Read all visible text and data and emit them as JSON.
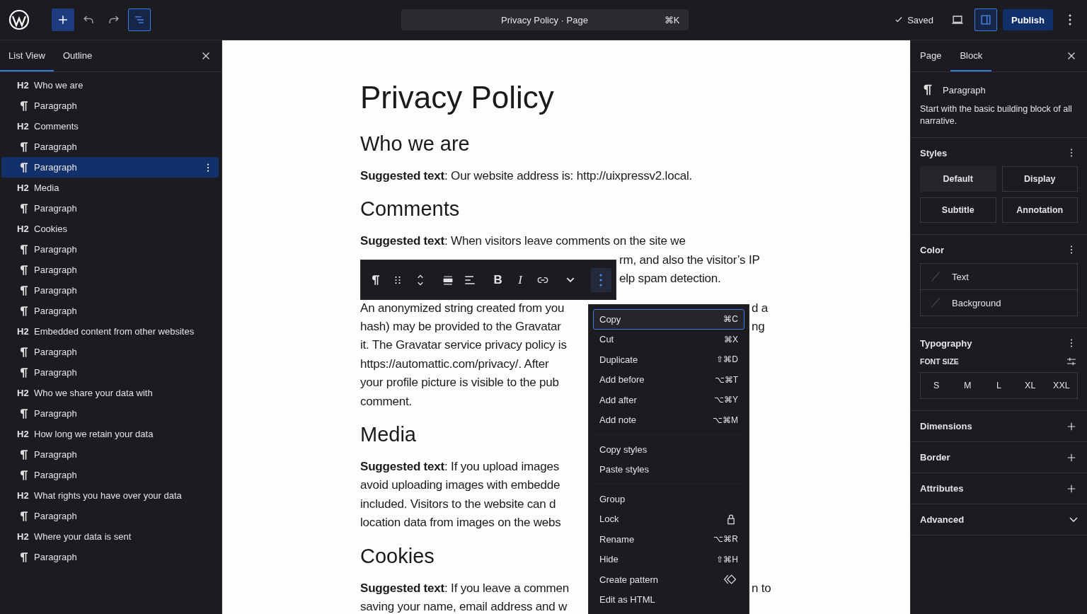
{
  "topbar": {
    "title": "Privacy Policy · Page",
    "shortcut": "⌘K",
    "saved": "Saved",
    "publish": "Publish",
    "list_view_on": true,
    "sidebar_on": true
  },
  "left_panel": {
    "tabs": [
      {
        "label": "List View",
        "selected": true
      },
      {
        "label": "Outline",
        "selected": false
      }
    ],
    "items": [
      {
        "kind": "heading",
        "tag": "H2",
        "label": "Who we are",
        "selected": false
      },
      {
        "kind": "paragraph",
        "label": "Paragraph",
        "selected": false
      },
      {
        "kind": "heading",
        "tag": "H2",
        "label": "Comments",
        "selected": false
      },
      {
        "kind": "paragraph",
        "label": "Paragraph",
        "selected": false
      },
      {
        "kind": "paragraph",
        "label": "Paragraph",
        "selected": true
      },
      {
        "kind": "heading",
        "tag": "H2",
        "label": "Media",
        "selected": false
      },
      {
        "kind": "paragraph",
        "label": "Paragraph",
        "selected": false
      },
      {
        "kind": "heading",
        "tag": "H2",
        "label": "Cookies",
        "selected": false
      },
      {
        "kind": "paragraph",
        "label": "Paragraph",
        "selected": false
      },
      {
        "kind": "paragraph",
        "label": "Paragraph",
        "selected": false
      },
      {
        "kind": "paragraph",
        "label": "Paragraph",
        "selected": false
      },
      {
        "kind": "paragraph",
        "label": "Paragraph",
        "selected": false
      },
      {
        "kind": "heading",
        "tag": "H2",
        "label": "Embedded content from other websites",
        "selected": false
      },
      {
        "kind": "paragraph",
        "label": "Paragraph",
        "selected": false
      },
      {
        "kind": "paragraph",
        "label": "Paragraph",
        "selected": false
      },
      {
        "kind": "heading",
        "tag": "H2",
        "label": "Who we share your data with",
        "selected": false
      },
      {
        "kind": "paragraph",
        "label": "Paragraph",
        "selected": false
      },
      {
        "kind": "heading",
        "tag": "H2",
        "label": "How long we retain your data",
        "selected": false
      },
      {
        "kind": "paragraph",
        "label": "Paragraph",
        "selected": false
      },
      {
        "kind": "paragraph",
        "label": "Paragraph",
        "selected": false
      },
      {
        "kind": "heading",
        "tag": "H2",
        "label": "What rights you have over your data",
        "selected": false
      },
      {
        "kind": "paragraph",
        "label": "Paragraph",
        "selected": false
      },
      {
        "kind": "heading",
        "tag": "H2",
        "label": "Where your data is sent",
        "selected": false
      },
      {
        "kind": "paragraph",
        "label": "Paragraph",
        "selected": false
      }
    ]
  },
  "editor": {
    "title": "Privacy Policy",
    "blocks": [
      {
        "kind": "heading",
        "text": "Who we are"
      },
      {
        "kind": "paragraph",
        "lines": [
          {
            "left": "**Suggested text**: Our website address is: http://uixpressv2.local."
          }
        ]
      },
      {
        "kind": "heading",
        "text": "Comments"
      },
      {
        "kind": "paragraph",
        "lines": [
          {
            "left": "**Suggested text**: When visitors leave comments on the site we"
          },
          {
            "kind": "toolbar",
            "right": "rm, and also the visitor’s IP"
          },
          {
            "kind": "toolbar",
            "right": "elp spam detection."
          }
        ]
      },
      {
        "kind": "paragraph",
        "lines": [
          {
            "kind": "menu",
            "left": "An anonymized string created from you",
            "right": "d a"
          },
          {
            "kind": "menu",
            "left": "hash) may be provided to the Gravatar",
            "right": "ng"
          },
          {
            "kind": "menu",
            "left": "it. The Gravatar service privacy policy is"
          },
          {
            "kind": "menu",
            "left": "https://automattic.com/privacy/. After"
          },
          {
            "kind": "menu",
            "left": "your profile picture is visible to the pub"
          },
          {
            "left": "comment."
          }
        ]
      },
      {
        "kind": "heading",
        "text": "Media"
      },
      {
        "kind": "paragraph",
        "lines": [
          {
            "kind": "menu",
            "left": "**Suggested text**: If you upload images"
          },
          {
            "kind": "menu",
            "left": "avoid uploading images with embedde"
          },
          {
            "kind": "menu",
            "left": "included. Visitors to the website can d"
          },
          {
            "kind": "menu",
            "left": "location data from images on the webs"
          }
        ]
      },
      {
        "kind": "heading",
        "text": "Cookies"
      },
      {
        "kind": "paragraph",
        "lines": [
          {
            "kind": "menu",
            "left": "**Suggested text**: If you leave a commen",
            "right": "n to"
          },
          {
            "kind": "menu",
            "left": "saving your name, email address and w"
          }
        ]
      }
    ]
  },
  "block_toolbar": {
    "buttons": [
      {
        "kind": "pilcrow",
        "selected": false
      },
      {
        "kind": "drag",
        "selected": false
      },
      {
        "kind": "move",
        "selected": false
      },
      {
        "kind": "align",
        "selected": false
      },
      {
        "kind": "align-left",
        "selected": false
      },
      {
        "kind": "text",
        "label": "B",
        "selected": false
      },
      {
        "kind": "italic",
        "label": "I",
        "selected": false
      },
      {
        "kind": "link",
        "selected": false
      },
      {
        "kind": "chevron",
        "selected": false
      },
      {
        "kind": "more",
        "selected": true
      }
    ]
  },
  "context_menu": {
    "groups": [
      [
        {
          "kind": "command",
          "label": "Copy",
          "shortcut": "⌘C",
          "selected": true
        },
        {
          "kind": "command",
          "label": "Cut",
          "shortcut": "⌘X",
          "selected": false
        },
        {
          "kind": "command",
          "label": "Duplicate",
          "shortcut": "⇧⌘D",
          "selected": false
        },
        {
          "kind": "command",
          "label": "Add before",
          "shortcut": "⌥⌘T",
          "selected": false
        },
        {
          "kind": "command",
          "label": "Add after",
          "shortcut": "⌥⌘Y",
          "selected": false
        },
        {
          "kind": "command",
          "label": "Add note",
          "shortcut": "⌥⌘M",
          "selected": false
        }
      ],
      [
        {
          "kind": "command",
          "label": "Copy styles",
          "selected": false
        },
        {
          "kind": "command",
          "label": "Paste styles",
          "selected": false
        }
      ],
      [
        {
          "kind": "command",
          "label": "Group",
          "selected": false
        },
        {
          "kind": "lock",
          "label": "Lock",
          "selected": false
        },
        {
          "kind": "command",
          "label": "Rename",
          "shortcut": "⌥⌘R",
          "selected": false
        },
        {
          "kind": "command",
          "label": "Hide",
          "shortcut": "⇧⌘H",
          "selected": false
        },
        {
          "kind": "pattern",
          "label": "Create pattern",
          "selected": false
        },
        {
          "kind": "command",
          "label": "Edit as HTML",
          "selected": false
        }
      ]
    ]
  },
  "right_panel": {
    "tabs": [
      {
        "label": "Page",
        "selected": false
      },
      {
        "label": "Block",
        "selected": true
      }
    ],
    "block": {
      "name": "Paragraph",
      "description": "Start with the basic building block of all narrative."
    },
    "styles": {
      "title": "Styles",
      "options": [
        {
          "label": "Default",
          "selected": true
        },
        {
          "label": "Display",
          "selected": false
        },
        {
          "label": "Subtitle",
          "selected": false
        },
        {
          "label": "Annotation",
          "selected": false
        }
      ]
    },
    "color": {
      "title": "Color",
      "items": [
        "Text",
        "Background"
      ]
    },
    "typography": {
      "title": "Typography",
      "font_size_label": "FONT SIZE",
      "sizes": [
        {
          "label": "S",
          "selected": false
        },
        {
          "label": "M",
          "selected": false
        },
        {
          "label": "L",
          "selected": false
        },
        {
          "label": "XL",
          "selected": false
        },
        {
          "label": "XXL",
          "selected": false
        }
      ]
    },
    "sections": [
      {
        "title": "Dimensions",
        "kind": "add"
      },
      {
        "title": "Border",
        "kind": "add"
      },
      {
        "title": "Attributes",
        "kind": "add"
      },
      {
        "title": "Advanced",
        "kind": "expand"
      }
    ]
  }
}
